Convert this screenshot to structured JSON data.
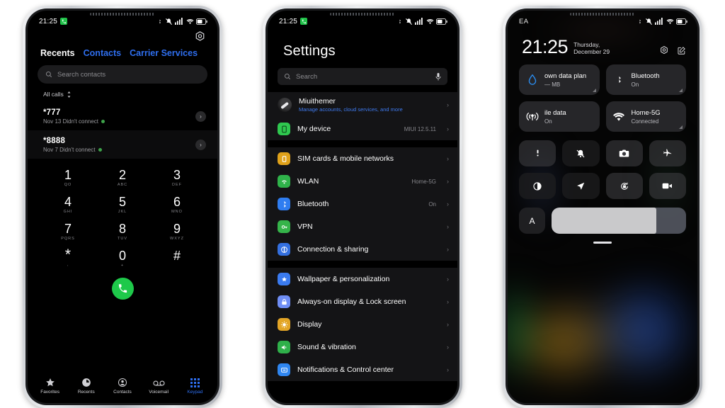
{
  "phone1": {
    "statusbar": {
      "time": "21:25",
      "icons": [
        "call-badge-icon",
        "bluetooth-icon",
        "vibrate-mute-icon",
        "signal-icon",
        "wifi-icon",
        "battery-icon"
      ]
    },
    "gear_icon": "settings-gear-icon",
    "tabs": [
      {
        "label": "Recents",
        "active": true
      },
      {
        "label": "Contacts",
        "active": false
      },
      {
        "label": "Carrier Services",
        "active": false
      }
    ],
    "search": {
      "placeholder": "Search contacts",
      "icon": "search-icon"
    },
    "filter": {
      "label": "All calls",
      "icon": "sort-updown-icon"
    },
    "calls": [
      {
        "number": "*777",
        "detail": "Nov 13 Didn't connect"
      },
      {
        "number": "*8888",
        "detail": "Nov 7 Didn't connect"
      }
    ],
    "dialpad": [
      {
        "digit": "1",
        "letters": "QO"
      },
      {
        "digit": "2",
        "letters": "ABC"
      },
      {
        "digit": "3",
        "letters": "DEF"
      },
      {
        "digit": "4",
        "letters": "GHI"
      },
      {
        "digit": "5",
        "letters": "JKL"
      },
      {
        "digit": "6",
        "letters": "MNO"
      },
      {
        "digit": "7",
        "letters": "PQRS"
      },
      {
        "digit": "8",
        "letters": "TUV"
      },
      {
        "digit": "9",
        "letters": "WXYZ"
      },
      {
        "digit": "*",
        "letters": ","
      },
      {
        "digit": "0",
        "letters": "+"
      },
      {
        "digit": "#",
        "letters": ""
      }
    ],
    "call_button": {
      "icon": "phone-call-icon",
      "color": "#1ec94a"
    },
    "nav": [
      {
        "label": "Favorites",
        "icon": "star-icon",
        "active": false
      },
      {
        "label": "Recents",
        "icon": "clock-icon",
        "active": false
      },
      {
        "label": "Contacts",
        "icon": "person-circle-icon",
        "active": false
      },
      {
        "label": "Voicemail",
        "icon": "voicemail-icon",
        "active": false
      },
      {
        "label": "Keypad",
        "icon": "keypad-grid-icon",
        "active": true
      }
    ],
    "accent_color": "#2f6ff0"
  },
  "phone2": {
    "statusbar": {
      "time": "21:25"
    },
    "title": "Settings",
    "search": {
      "placeholder": "Search",
      "icon": "search-icon",
      "mic_icon": "microphone-icon"
    },
    "account": {
      "name": "Miuithemer",
      "subtitle": "Manage accounts, cloud services, and more",
      "icon": "account-avatar"
    },
    "device": {
      "label": "My device",
      "value": "MIUI 12.5.11",
      "icon": "phone-icon",
      "color": "#2fc84f"
    },
    "group_network": [
      {
        "label": "SIM cards & mobile networks",
        "value": "",
        "icon": "sim-card-icon",
        "color": "#e0a21a"
      },
      {
        "label": "WLAN",
        "value": "Home-5G",
        "icon": "wifi-icon",
        "color": "#2fb34a"
      },
      {
        "label": "Bluetooth",
        "value": "On",
        "icon": "bluetooth-icon",
        "color": "#2f7df0"
      },
      {
        "label": "VPN",
        "value": "",
        "icon": "key-icon",
        "color": "#35b44a"
      },
      {
        "label": "Connection & sharing",
        "value": "",
        "icon": "connection-icon",
        "color": "#3470e0"
      }
    ],
    "group_system": [
      {
        "label": "Wallpaper & personalization",
        "value": "",
        "icon": "star-badge-icon",
        "color": "#3a7bf0"
      },
      {
        "label": "Always-on display & Lock screen",
        "value": "",
        "icon": "lock-icon",
        "color": "#6f8ef5"
      },
      {
        "label": "Display",
        "value": "",
        "icon": "brightness-icon",
        "color": "#e3a526"
      },
      {
        "label": "Sound & vibration",
        "value": "",
        "icon": "speaker-icon",
        "color": "#2fb04a"
      },
      {
        "label": "Notifications & Control center",
        "value": "",
        "icon": "notification-icon",
        "color": "#2f86f0"
      }
    ],
    "chevron": "›"
  },
  "phone3": {
    "statusbar": {
      "carrier": "EA"
    },
    "clock": "21:25",
    "date": "Thursday, December 29",
    "head_icons": [
      "settings-gear-icon",
      "edit-pencil-icon"
    ],
    "tiles": [
      {
        "title": "own data plan",
        "sub": "— MB",
        "icon": "data-drop-icon",
        "accent": "#2b8df0"
      },
      {
        "title": "Bluetooth",
        "sub": "On",
        "icon": "bluetooth-icon",
        "accent": "#ffffff"
      },
      {
        "title": "ile data",
        "sub": "On",
        "icon": "mobile-data-icon",
        "accent": "#ffffff"
      },
      {
        "title": "Home-5G",
        "sub": "Connected",
        "icon": "wifi-icon",
        "accent": "#ffffff"
      }
    ],
    "quick_toggles": [
      {
        "icon": "flashlight-icon",
        "on": false
      },
      {
        "icon": "bell-mute-icon",
        "on": true
      },
      {
        "icon": "camera-icon",
        "on": false
      },
      {
        "icon": "airplane-icon",
        "on": false
      },
      {
        "icon": "contrast-icon",
        "on": true
      },
      {
        "icon": "location-arrow-icon",
        "on": true
      },
      {
        "icon": "rotation-lock-icon",
        "on": false
      },
      {
        "icon": "video-camera-icon",
        "on": false
      }
    ],
    "brightness": {
      "auto_label": "A",
      "value": 78
    },
    "handle": "drag-handle"
  }
}
